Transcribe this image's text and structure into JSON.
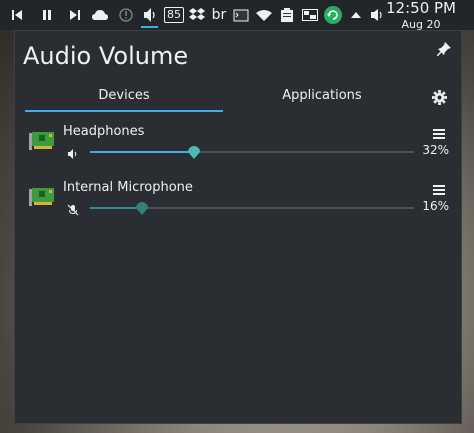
{
  "panel": {
    "tray_85": "85",
    "tray_lang": "br",
    "clock_time": "12:50 PM",
    "clock_date": "Aug 20"
  },
  "popup": {
    "title": "Audio Volume",
    "tabs": [
      {
        "label": "Devices",
        "active": true
      },
      {
        "label": "Applications",
        "active": false
      }
    ],
    "devices": [
      {
        "name": "Headphones",
        "volume": 32,
        "volume_label": "32%",
        "muted": false
      },
      {
        "name": "Internal Microphone",
        "volume": 16,
        "volume_label": "16%",
        "muted": true
      }
    ]
  },
  "colors": {
    "accent": "#3daee9",
    "handle": "#4fb8b0",
    "panel_bg": "#232629",
    "popup_bg": "#2a2e32"
  }
}
